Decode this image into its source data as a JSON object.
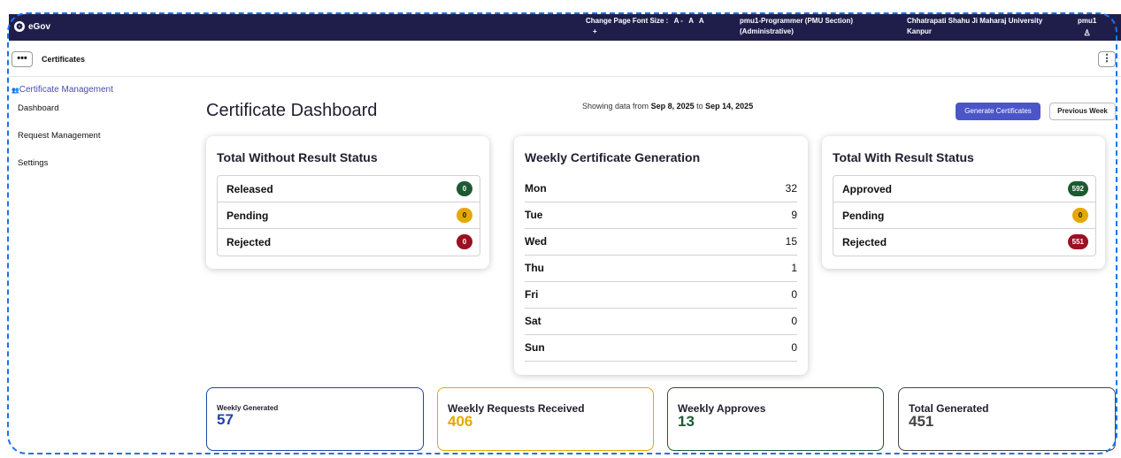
{
  "colors": {
    "topbar": "#1f1e4b",
    "accent": "#4a55c8",
    "green": "#1d5a32",
    "yellow": "#e5a800",
    "red": "#9b1022",
    "blue": "#1f43a8"
  },
  "topbar": {
    "brand": "eGov",
    "brand_icon": "egov-logo-icon",
    "font_size_label": "Change Page Font Size :",
    "font_buttons": [
      "A -",
      "A",
      "A"
    ],
    "font_plus": "+",
    "user_role_line1": "pmu1-Programmer (PMU Section)",
    "user_role_line2": "(Administrative)",
    "university_line1": "Chhatrapati Shahu Ji Maharaj University",
    "university_line2": "Kanpur",
    "user_name": "pmu1",
    "user_icon": "user-icon"
  },
  "subbar": {
    "menu_label": "•••",
    "title": "Certificates",
    "kebab_label": "⋮"
  },
  "sidebar": {
    "heading": "Certificate Management",
    "items": [
      "Dashboard",
      "Request Management",
      "Settings"
    ]
  },
  "main": {
    "title": "Certificate Dashboard",
    "date_prefix": "Showing data from",
    "date_from": "Sep 8, 2025",
    "date_to_word": "to",
    "date_to": "Sep 14, 2025",
    "generate_button": "Generate Certificates",
    "previous_button": "Previous Week"
  },
  "without_result": {
    "title": "Total Without Result Status",
    "rows": [
      {
        "label": "Released",
        "value": "0"
      },
      {
        "label": "Pending",
        "value": "0"
      },
      {
        "label": "Rejected",
        "value": "0"
      }
    ]
  },
  "weekly_generation": {
    "title": "Weekly Certificate Generation",
    "rows": [
      {
        "day": "Mon",
        "value": "32"
      },
      {
        "day": "Tue",
        "value": "9"
      },
      {
        "day": "Wed",
        "value": "15"
      },
      {
        "day": "Thu",
        "value": "1"
      },
      {
        "day": "Fri",
        "value": "0"
      },
      {
        "day": "Sat",
        "value": "0"
      },
      {
        "day": "Sun",
        "value": "0"
      }
    ]
  },
  "with_result": {
    "title": "Total With Result Status",
    "rows": [
      {
        "label": "Approved",
        "value": "592"
      },
      {
        "label": "Pending",
        "value": "0"
      },
      {
        "label": "Rejected",
        "value": "551"
      }
    ]
  },
  "stats": [
    {
      "label": "Weekly Generated",
      "value": "57"
    },
    {
      "label": "Weekly Requests Received",
      "value": "406"
    },
    {
      "label": "Weekly Approves",
      "value": "13"
    },
    {
      "label": "Total Generated",
      "value": "451"
    }
  ]
}
